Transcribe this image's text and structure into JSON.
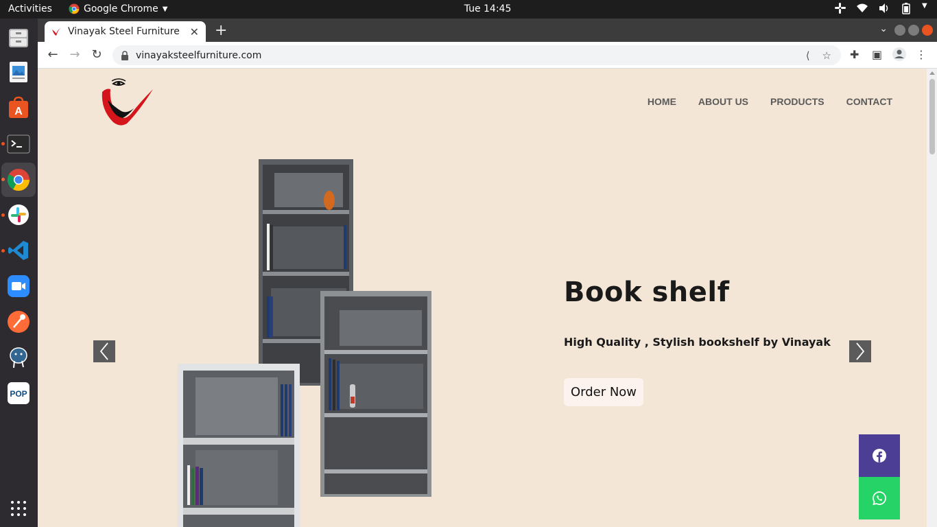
{
  "system": {
    "activities": "Activities",
    "app_name": "Google Chrome",
    "clock": "Tue 14:45"
  },
  "dock": {
    "items": [
      "file-cabinet-icon",
      "image-viewer-icon",
      "app-store-icon",
      "terminal-icon",
      "chrome-icon",
      "slack-icon",
      "vscode-icon",
      "zoom-icon",
      "postman-icon",
      "postgres-icon",
      "pop-icon"
    ]
  },
  "browser": {
    "tab_title": "Vinayak Steel Furniture",
    "url": "vinayaksteelfurniture.com"
  },
  "site": {
    "nav": {
      "home": "HOME",
      "about": "ABOUT US",
      "products": "PRODUCTS",
      "contact": "CONTACT"
    },
    "hero": {
      "title": "Book shelf",
      "subtitle": "High Quality , Stylish bookshelf by Vinayak",
      "cta": "Order Now"
    }
  },
  "colors": {
    "page_bg": "#f3e6d7",
    "facebook": "#4d3e95",
    "whatsapp": "#25d366",
    "logo_red": "#d4161c"
  }
}
